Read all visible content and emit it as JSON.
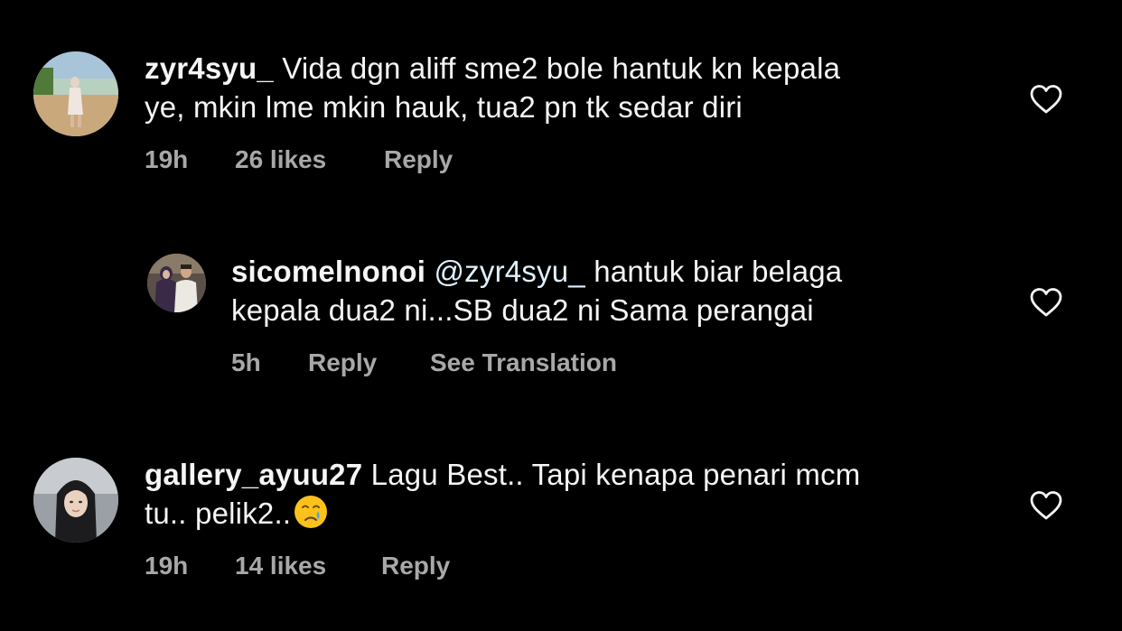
{
  "comments": [
    {
      "username": "zyr4syu_",
      "text": "Vida dgn aliff sme2 bole hantuk kn kepala ye, mkin lme mkin hauk, tua2 pn tk sedar diri",
      "line1": "Vida dgn aliff sme2 bole hantuk kn kepala",
      "line2": "ye, mkin lme mkin hauk, tua2 pn tk sedar diri",
      "time": "19h",
      "likes": "26 likes",
      "reply": "Reply"
    },
    {
      "username": "sicomelnonoi",
      "mention": "@zyr4syu_",
      "line1": "hantuk biar belaga",
      "line2": "kepala dua2 ni...SB dua2 ni Sama perangai",
      "time": "5h",
      "reply": "Reply",
      "translation": "See Translation"
    },
    {
      "username": "gallery_ayuu27",
      "line1": "Lagu Best.. Tapi kenapa penari mcm",
      "line2": "tu.. pelik2..",
      "emoji": "crying-face-emoji",
      "time": "19h",
      "likes": "14 likes",
      "reply": "Reply"
    }
  ],
  "colors": {
    "background": "#000000",
    "text": "#f5f5f5",
    "meta": "#a8a8a8",
    "heart": "#f5f5f5"
  },
  "icons": {
    "like": "heart-outline-icon"
  }
}
